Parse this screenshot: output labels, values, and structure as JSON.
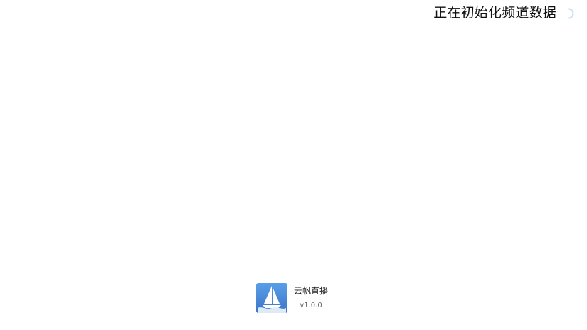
{
  "status": {
    "text": "正在初始化频道数据",
    "spinner_icon": "loading-spinner-icon"
  },
  "app": {
    "name": "云帆直播",
    "version": "v1.0.0",
    "logo_icon": "sailboat-logo-icon",
    "logo_caption": "云帆直播"
  },
  "colors": {
    "background": "#ffffff",
    "text": "#111111",
    "accent": "#4a86d8",
    "spinner": "#cfe0f4"
  }
}
